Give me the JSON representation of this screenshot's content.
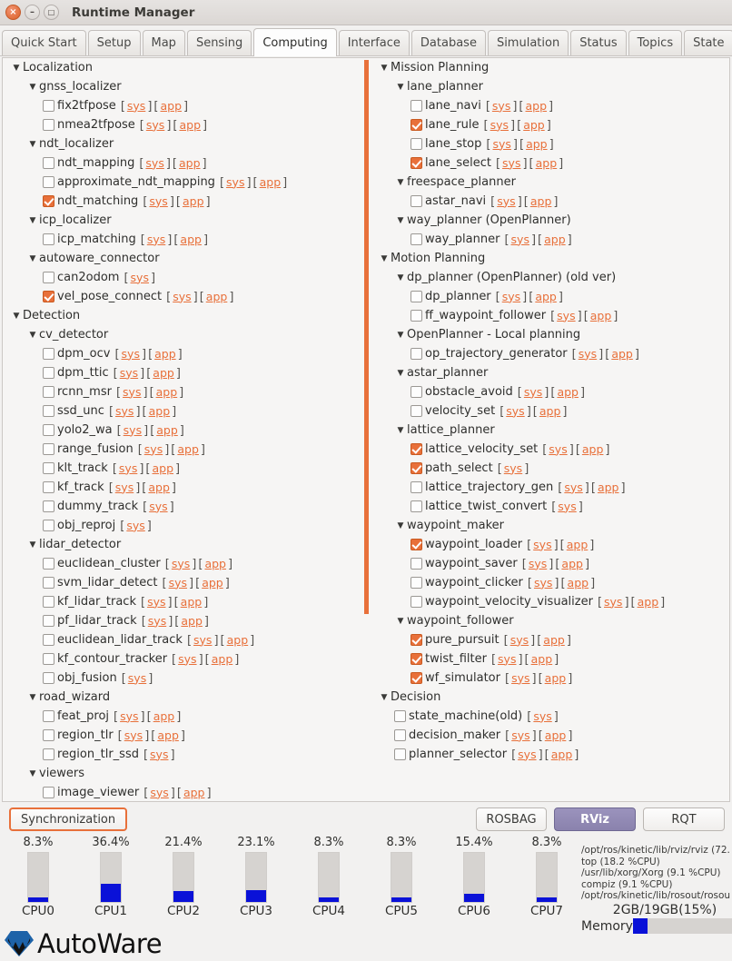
{
  "window": {
    "title": "Runtime Manager",
    "close_icon": "close-icon",
    "minimize_icon": "minimize-icon",
    "maximize_icon": "maximize-icon",
    "close_glyph": "×",
    "minimize_glyph": "–",
    "maximize_glyph": "□"
  },
  "colors": {
    "accent": "#e8703a",
    "link": "#e8703a",
    "cpu_fill": "#0a11d8",
    "cpu_track": "#d6d3d0",
    "pressed_button": "#8a82ad",
    "panel_bg": "#f6f5f4"
  },
  "tabs": [
    {
      "label": "Quick Start",
      "active": false
    },
    {
      "label": "Setup",
      "active": false
    },
    {
      "label": "Map",
      "active": false
    },
    {
      "label": "Sensing",
      "active": false
    },
    {
      "label": "Computing",
      "active": true
    },
    {
      "label": "Interface",
      "active": false
    },
    {
      "label": "Database",
      "active": false
    },
    {
      "label": "Simulation",
      "active": false
    },
    {
      "label": "Status",
      "active": false
    },
    {
      "label": "Topics",
      "active": false
    },
    {
      "label": "State",
      "active": false
    }
  ],
  "link_labels": {
    "sys": "sys",
    "app": "app",
    "open": "[",
    "close": "]"
  },
  "tree_left": [
    {
      "type": "group",
      "indent": 0,
      "label": "Localization"
    },
    {
      "type": "group",
      "indent": 1,
      "label": "gnss_localizer"
    },
    {
      "type": "node",
      "indent": 2,
      "label": "fix2tfpose",
      "checked": false,
      "links": [
        "sys",
        "app"
      ]
    },
    {
      "type": "node",
      "indent": 2,
      "label": "nmea2tfpose",
      "checked": false,
      "links": [
        "sys",
        "app"
      ]
    },
    {
      "type": "group",
      "indent": 1,
      "label": "ndt_localizer"
    },
    {
      "type": "node",
      "indent": 2,
      "label": "ndt_mapping",
      "checked": false,
      "links": [
        "sys",
        "app"
      ]
    },
    {
      "type": "node",
      "indent": 2,
      "label": "approximate_ndt_mapping",
      "checked": false,
      "links": [
        "sys",
        "app"
      ]
    },
    {
      "type": "node",
      "indent": 2,
      "label": "ndt_matching",
      "checked": true,
      "links": [
        "sys",
        "app"
      ]
    },
    {
      "type": "group",
      "indent": 1,
      "label": "icp_localizer"
    },
    {
      "type": "node",
      "indent": 2,
      "label": "icp_matching",
      "checked": false,
      "links": [
        "sys",
        "app"
      ]
    },
    {
      "type": "group",
      "indent": 1,
      "label": "autoware_connector"
    },
    {
      "type": "node",
      "indent": 2,
      "label": "can2odom",
      "checked": false,
      "links": [
        "sys"
      ]
    },
    {
      "type": "node",
      "indent": 2,
      "label": "vel_pose_connect",
      "checked": true,
      "links": [
        "sys",
        "app"
      ]
    },
    {
      "type": "group",
      "indent": 0,
      "label": "Detection"
    },
    {
      "type": "group",
      "indent": 1,
      "label": "cv_detector"
    },
    {
      "type": "node",
      "indent": 2,
      "label": "dpm_ocv",
      "checked": false,
      "links": [
        "sys",
        "app"
      ]
    },
    {
      "type": "node",
      "indent": 2,
      "label": "dpm_ttic",
      "checked": false,
      "links": [
        "sys",
        "app"
      ]
    },
    {
      "type": "node",
      "indent": 2,
      "label": "rcnn_msr",
      "checked": false,
      "links": [
        "sys",
        "app"
      ]
    },
    {
      "type": "node",
      "indent": 2,
      "label": "ssd_unc",
      "checked": false,
      "links": [
        "sys",
        "app"
      ]
    },
    {
      "type": "node",
      "indent": 2,
      "label": "yolo2_wa",
      "checked": false,
      "links": [
        "sys",
        "app"
      ]
    },
    {
      "type": "node",
      "indent": 2,
      "label": "range_fusion",
      "checked": false,
      "links": [
        "sys",
        "app"
      ]
    },
    {
      "type": "node",
      "indent": 2,
      "label": "klt_track",
      "checked": false,
      "links": [
        "sys",
        "app"
      ]
    },
    {
      "type": "node",
      "indent": 2,
      "label": "kf_track",
      "checked": false,
      "links": [
        "sys",
        "app"
      ]
    },
    {
      "type": "node",
      "indent": 2,
      "label": "dummy_track",
      "checked": false,
      "links": [
        "sys"
      ]
    },
    {
      "type": "node",
      "indent": 2,
      "label": "obj_reproj",
      "checked": false,
      "links": [
        "sys"
      ]
    },
    {
      "type": "group",
      "indent": 1,
      "label": "lidar_detector"
    },
    {
      "type": "node",
      "indent": 2,
      "label": "euclidean_cluster",
      "checked": false,
      "links": [
        "sys",
        "app"
      ]
    },
    {
      "type": "node",
      "indent": 2,
      "label": "svm_lidar_detect",
      "checked": false,
      "links": [
        "sys",
        "app"
      ]
    },
    {
      "type": "node",
      "indent": 2,
      "label": "kf_lidar_track",
      "checked": false,
      "links": [
        "sys",
        "app"
      ]
    },
    {
      "type": "node",
      "indent": 2,
      "label": "pf_lidar_track",
      "checked": false,
      "links": [
        "sys",
        "app"
      ]
    },
    {
      "type": "node",
      "indent": 2,
      "label": "euclidean_lidar_track",
      "checked": false,
      "links": [
        "sys",
        "app"
      ]
    },
    {
      "type": "node",
      "indent": 2,
      "label": "kf_contour_tracker",
      "checked": false,
      "links": [
        "sys",
        "app"
      ]
    },
    {
      "type": "node",
      "indent": 2,
      "label": "obj_fusion",
      "checked": false,
      "links": [
        "sys"
      ]
    },
    {
      "type": "group",
      "indent": 1,
      "label": "road_wizard"
    },
    {
      "type": "node",
      "indent": 2,
      "label": "feat_proj",
      "checked": false,
      "links": [
        "sys",
        "app"
      ]
    },
    {
      "type": "node",
      "indent": 2,
      "label": "region_tlr",
      "checked": false,
      "links": [
        "sys",
        "app"
      ]
    },
    {
      "type": "node",
      "indent": 2,
      "label": "region_tlr_ssd",
      "checked": false,
      "links": [
        "sys"
      ]
    },
    {
      "type": "group",
      "indent": 1,
      "label": "viewers"
    },
    {
      "type": "node",
      "indent": 2,
      "label": "image_viewer",
      "checked": false,
      "links": [
        "sys",
        "app"
      ]
    }
  ],
  "tree_right": [
    {
      "type": "group",
      "indent": 0,
      "label": "Mission Planning"
    },
    {
      "type": "group",
      "indent": 1,
      "label": "lane_planner"
    },
    {
      "type": "node",
      "indent": 2,
      "label": "lane_navi",
      "checked": false,
      "links": [
        "sys",
        "app"
      ]
    },
    {
      "type": "node",
      "indent": 2,
      "label": "lane_rule",
      "checked": true,
      "links": [
        "sys",
        "app"
      ]
    },
    {
      "type": "node",
      "indent": 2,
      "label": "lane_stop",
      "checked": false,
      "links": [
        "sys",
        "app"
      ]
    },
    {
      "type": "node",
      "indent": 2,
      "label": "lane_select",
      "checked": true,
      "links": [
        "sys",
        "app"
      ]
    },
    {
      "type": "group",
      "indent": 1,
      "label": "freespace_planner"
    },
    {
      "type": "node",
      "indent": 2,
      "label": "astar_navi",
      "checked": false,
      "links": [
        "sys",
        "app"
      ]
    },
    {
      "type": "group",
      "indent": 1,
      "label": "way_planner (OpenPlanner)"
    },
    {
      "type": "node",
      "indent": 2,
      "label": "way_planner",
      "checked": false,
      "links": [
        "sys",
        "app"
      ]
    },
    {
      "type": "group",
      "indent": 0,
      "label": "Motion Planning"
    },
    {
      "type": "group",
      "indent": 1,
      "label": "dp_planner (OpenPlanner) (old ver)"
    },
    {
      "type": "node",
      "indent": 2,
      "label": "dp_planner",
      "checked": false,
      "links": [
        "sys",
        "app"
      ]
    },
    {
      "type": "node",
      "indent": 2,
      "label": "ff_waypoint_follower",
      "checked": false,
      "links": [
        "sys",
        "app"
      ]
    },
    {
      "type": "group",
      "indent": 1,
      "label": "OpenPlanner - Local planning"
    },
    {
      "type": "node",
      "indent": 2,
      "label": "op_trajectory_generator",
      "checked": false,
      "links": [
        "sys",
        "app"
      ]
    },
    {
      "type": "group",
      "indent": 1,
      "label": "astar_planner"
    },
    {
      "type": "node",
      "indent": 2,
      "label": "obstacle_avoid",
      "checked": false,
      "links": [
        "sys",
        "app"
      ]
    },
    {
      "type": "node",
      "indent": 2,
      "label": "velocity_set",
      "checked": false,
      "links": [
        "sys",
        "app"
      ]
    },
    {
      "type": "group",
      "indent": 1,
      "label": "lattice_planner"
    },
    {
      "type": "node",
      "indent": 2,
      "label": "lattice_velocity_set",
      "checked": true,
      "links": [
        "sys",
        "app"
      ]
    },
    {
      "type": "node",
      "indent": 2,
      "label": "path_select",
      "checked": true,
      "links": [
        "sys"
      ]
    },
    {
      "type": "node",
      "indent": 2,
      "label": "lattice_trajectory_gen",
      "checked": false,
      "links": [
        "sys",
        "app"
      ]
    },
    {
      "type": "node",
      "indent": 2,
      "label": "lattice_twist_convert",
      "checked": false,
      "links": [
        "sys"
      ]
    },
    {
      "type": "group",
      "indent": 1,
      "label": "waypoint_maker"
    },
    {
      "type": "node",
      "indent": 2,
      "label": "waypoint_loader",
      "checked": true,
      "links": [
        "sys",
        "app"
      ]
    },
    {
      "type": "node",
      "indent": 2,
      "label": "waypoint_saver",
      "checked": false,
      "links": [
        "sys",
        "app"
      ]
    },
    {
      "type": "node",
      "indent": 2,
      "label": "waypoint_clicker",
      "checked": false,
      "links": [
        "sys",
        "app"
      ]
    },
    {
      "type": "node",
      "indent": 2,
      "label": "waypoint_velocity_visualizer",
      "checked": false,
      "links": [
        "sys",
        "app"
      ]
    },
    {
      "type": "group",
      "indent": 1,
      "label": "waypoint_follower"
    },
    {
      "type": "node",
      "indent": 2,
      "label": "pure_pursuit",
      "checked": true,
      "links": [
        "sys",
        "app"
      ]
    },
    {
      "type": "node",
      "indent": 2,
      "label": "twist_filter",
      "checked": true,
      "links": [
        "sys",
        "app"
      ]
    },
    {
      "type": "node",
      "indent": 2,
      "label": "wf_simulator",
      "checked": true,
      "links": [
        "sys",
        "app"
      ]
    },
    {
      "type": "group",
      "indent": 0,
      "label": "Decision"
    },
    {
      "type": "node",
      "indent": 1,
      "label": "state_machine(old)",
      "checked": false,
      "links": [
        "sys"
      ]
    },
    {
      "type": "node",
      "indent": 1,
      "label": "decision_maker",
      "checked": false,
      "links": [
        "sys",
        "app"
      ]
    },
    {
      "type": "node",
      "indent": 1,
      "label": "planner_selector",
      "checked": false,
      "links": [
        "sys",
        "app"
      ]
    }
  ],
  "buttons": {
    "synchronization": "Synchronization",
    "rosbag": "ROSBAG",
    "rviz": "RViz",
    "rqt": "RQT"
  },
  "cpus": [
    {
      "label": "CPU0",
      "percent": "8.3%",
      "value": 8.3
    },
    {
      "label": "CPU1",
      "percent": "36.4%",
      "value": 36.4
    },
    {
      "label": "CPU2",
      "percent": "21.4%",
      "value": 21.4
    },
    {
      "label": "CPU3",
      "percent": "23.1%",
      "value": 23.1
    },
    {
      "label": "CPU4",
      "percent": "8.3%",
      "value": 8.3
    },
    {
      "label": "CPU5",
      "percent": "8.3%",
      "value": 8.3
    },
    {
      "label": "CPU6",
      "percent": "15.4%",
      "value": 15.4
    },
    {
      "label": "CPU7",
      "percent": "8.3%",
      "value": 8.3
    }
  ],
  "processes": [
    "/opt/ros/kinetic/lib/rviz/rviz (72.",
    "top (18.2 %CPU)",
    "/usr/lib/xorg/Xorg (9.1 %CPU)",
    "compiz (9.1 %CPU)",
    "/opt/ros/kinetic/lib/rosout/rosou"
  ],
  "memory": {
    "text": "2GB/19GB(15%)",
    "label": "Memory",
    "percent": 15
  },
  "logo": {
    "text": "AutoWare",
    "mark": "autoware-logo-icon"
  }
}
